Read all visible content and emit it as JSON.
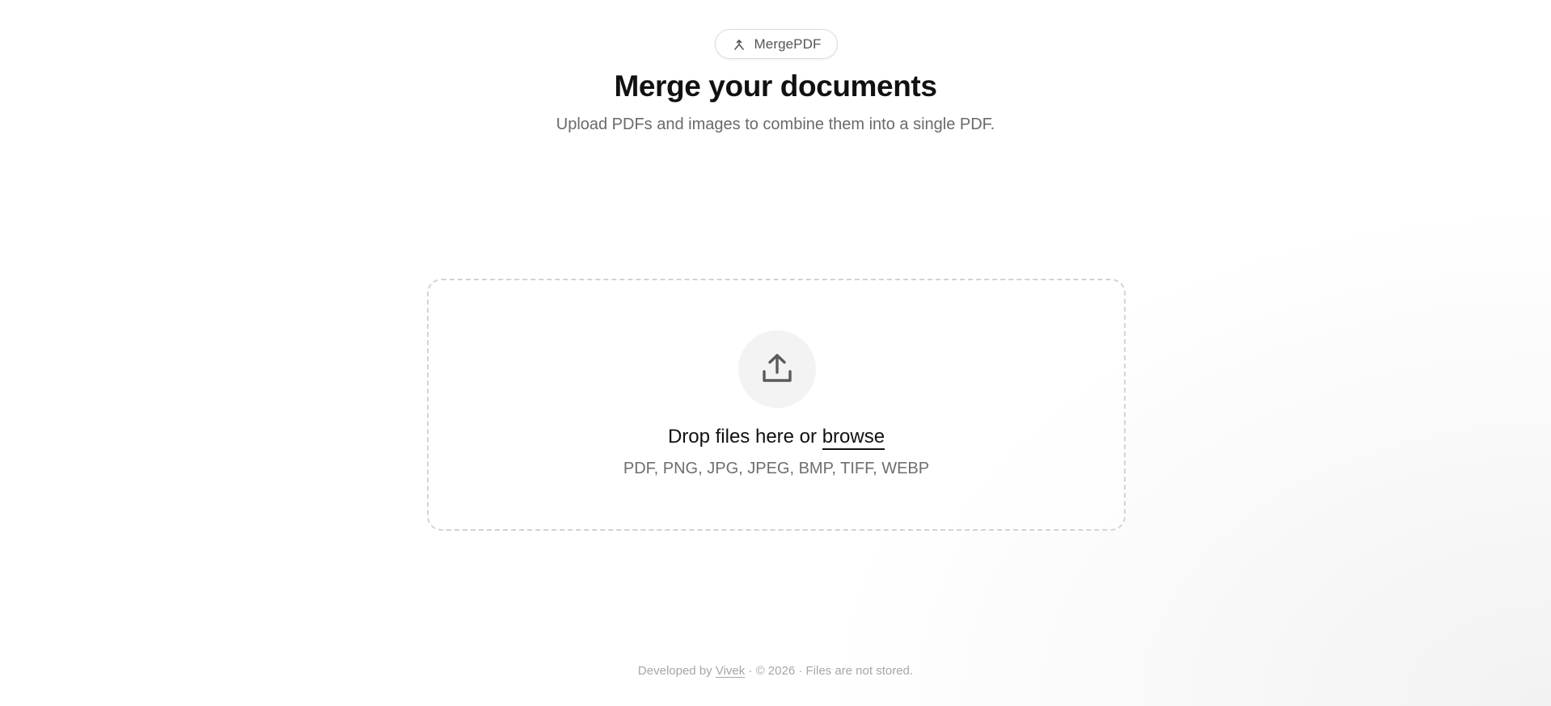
{
  "brand": {
    "label": "MergePDF",
    "icon": "merge-icon"
  },
  "hero": {
    "title": "Merge your documents",
    "subtitle": "Upload PDFs and images to combine them into a single PDF."
  },
  "dropzone": {
    "icon": "upload-icon",
    "prompt_prefix": "Drop files here or ",
    "browse_label": "browse",
    "formats": "PDF, PNG, JPG, JPEG, BMP, TIFF, WEBP"
  },
  "footer": {
    "prefix": "Developed by ",
    "author": "Vivek",
    "suffix": " · © 2026 · Files are not stored."
  },
  "colors": {
    "text_primary": "#111111",
    "text_secondary": "#6a6a6a",
    "border_dashed": "#d4d4d4",
    "icon_circle_bg": "#f3f3f3",
    "footer_text": "#a6a6a6"
  }
}
